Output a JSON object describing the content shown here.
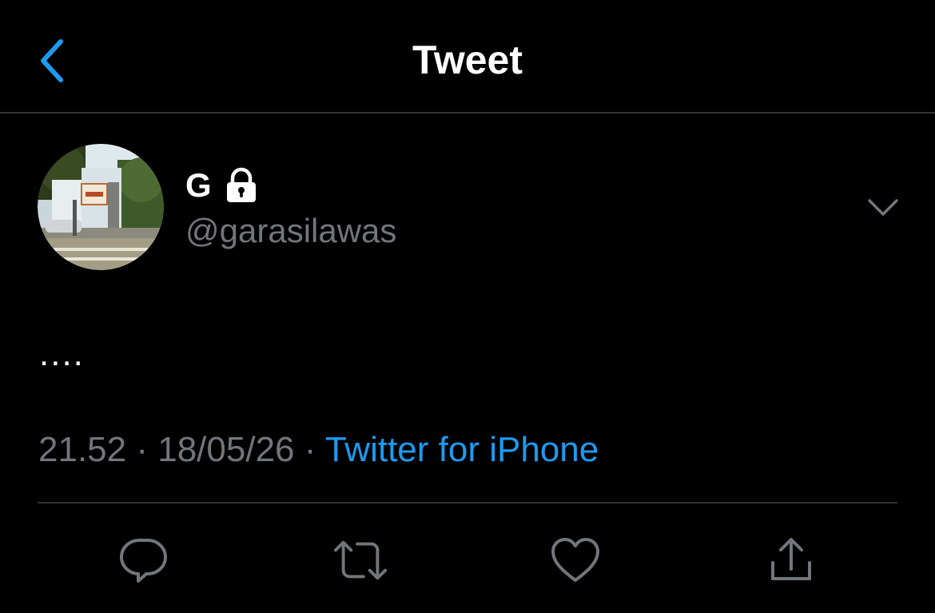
{
  "nav": {
    "title": "Tweet",
    "back_icon": "chevron-left-icon"
  },
  "colors": {
    "background": "#000000",
    "accent": "#1d9bf0",
    "secondary_text": "#71767b",
    "divider": "#2f3336"
  },
  "tweet": {
    "author": {
      "display_name": "G",
      "handle": "@garasilawas",
      "protected_icon": "lock-icon",
      "avatar": "street-photo-avatar"
    },
    "text": "....",
    "time": "21.52",
    "separator": "·",
    "date": "18/05/26",
    "source": "Twitter for iPhone"
  },
  "actions": [
    {
      "name": "reply",
      "icon": "reply-icon"
    },
    {
      "name": "retweet",
      "icon": "retweet-icon"
    },
    {
      "name": "like",
      "icon": "heart-icon"
    },
    {
      "name": "share",
      "icon": "share-icon"
    }
  ]
}
